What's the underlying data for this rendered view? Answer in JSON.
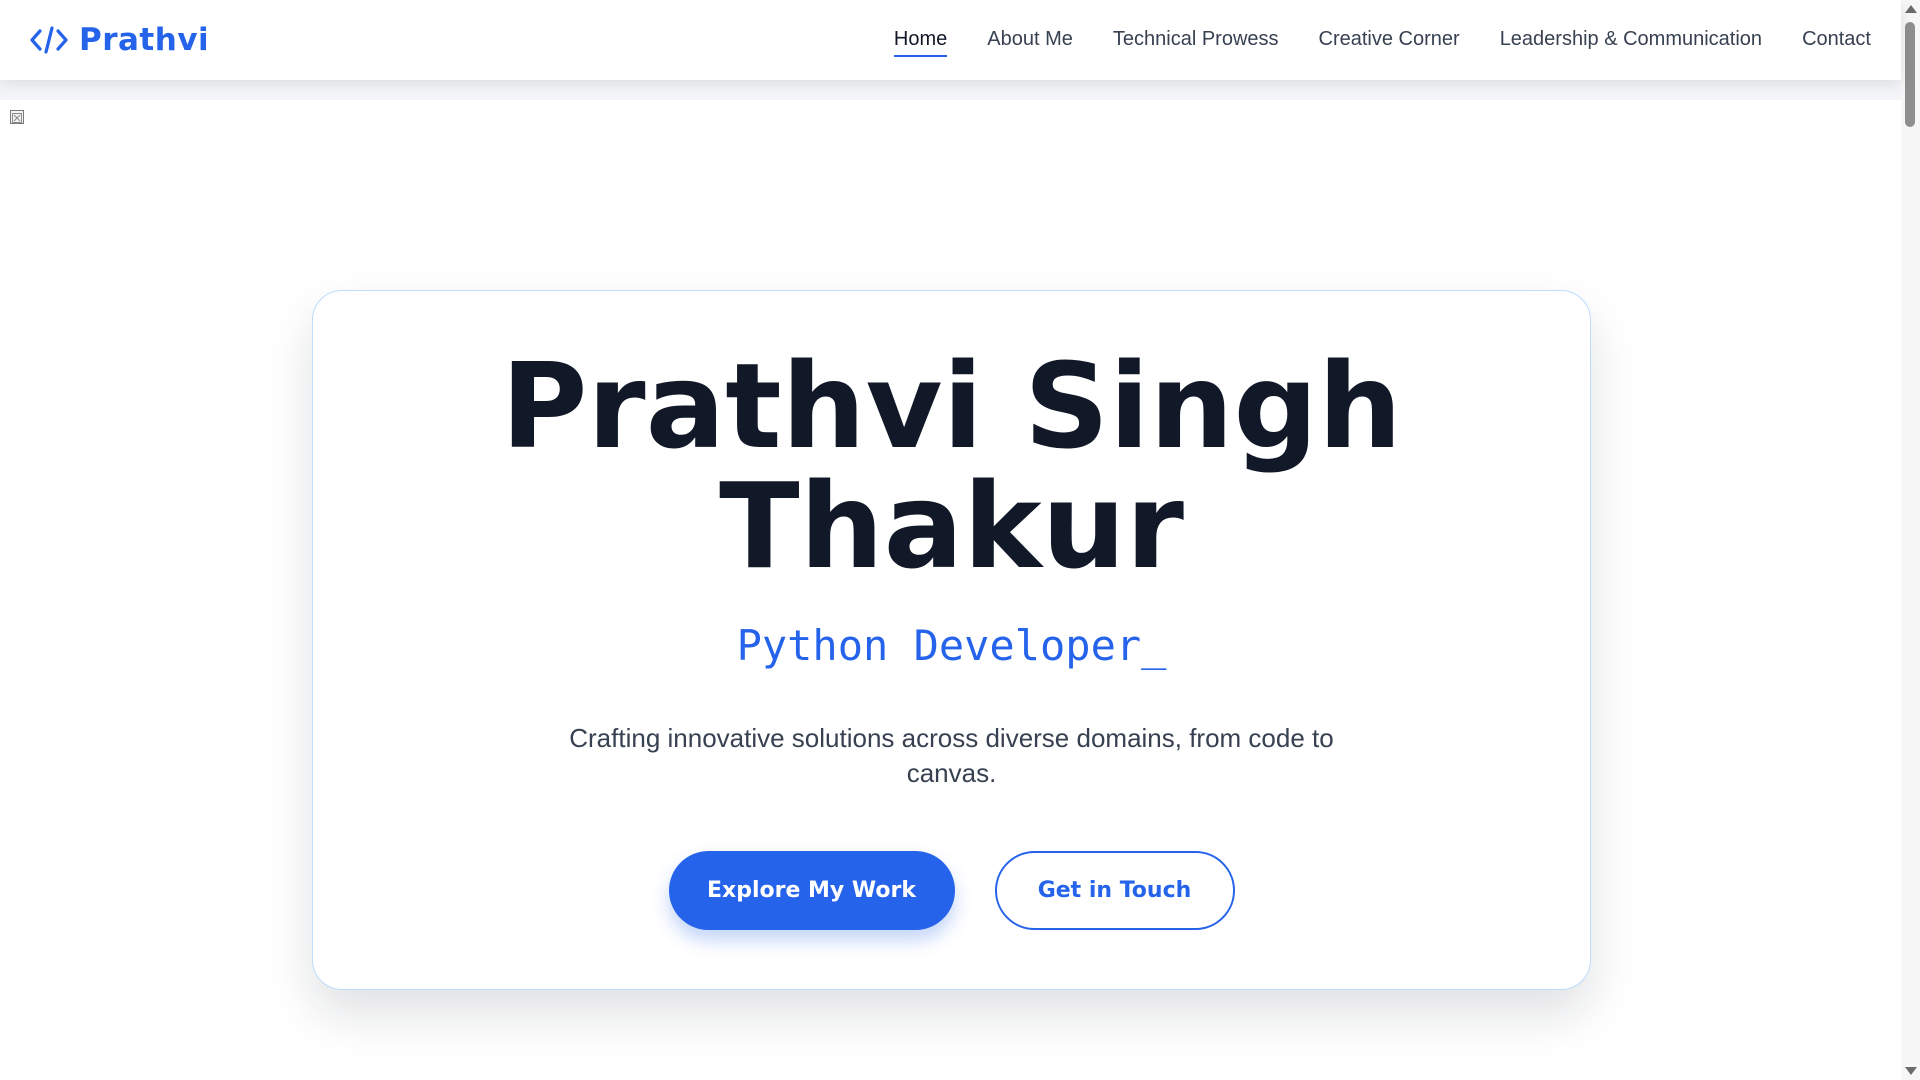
{
  "brand": {
    "icon": "code-brackets-icon",
    "name": "Prathvi"
  },
  "nav": {
    "items": [
      {
        "label": "Home",
        "active": true
      },
      {
        "label": "About Me",
        "active": false
      },
      {
        "label": "Technical Prowess",
        "active": false
      },
      {
        "label": "Creative Corner",
        "active": false
      },
      {
        "label": "Leadership & Communication",
        "active": false
      },
      {
        "label": "Contact",
        "active": false
      }
    ]
  },
  "hero": {
    "name_line1": "Prathvi Singh",
    "name_line2": "Thakur",
    "role": "Python Developer_",
    "tagline": "Crafting innovative solutions across diverse domains, from code to canvas.",
    "primary_button": "Explore My Work",
    "secondary_button": "Get in Touch"
  },
  "colors": {
    "accent": "#2563eb",
    "heading": "#111827",
    "body_text": "#374151",
    "card_border": "#bfdbfe"
  }
}
